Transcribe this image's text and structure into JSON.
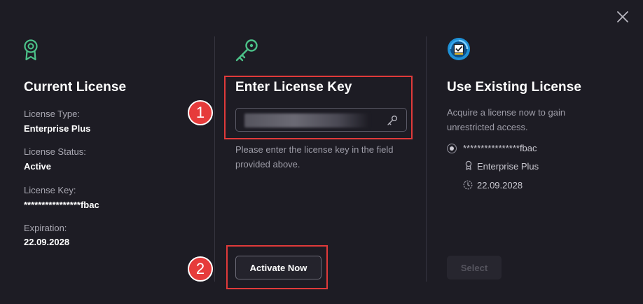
{
  "dialog": {
    "close_icon": "close-icon"
  },
  "current_license": {
    "icon": "award-ribbon-icon",
    "title": "Current License",
    "type_label": "License Type:",
    "type_value": "Enterprise Plus",
    "status_label": "License Status:",
    "status_value": "Active",
    "key_label": "License Key:",
    "key_value": "****************fbac",
    "expiration_label": "Expiration:",
    "expiration_value": "22.09.2028"
  },
  "enter_key": {
    "icon": "key-icon",
    "title": "Enter License Key",
    "input_value": "",
    "input_placeholder": "",
    "help_text": "Please enter the license key in the field provided above.",
    "activate_label": "Activate Now"
  },
  "existing_license": {
    "icon": "license-shield-icon",
    "title": "Use Existing License",
    "description": "Acquire a license now to gain unrestricted access.",
    "option_key": "****************fbac",
    "option_edition": "Enterprise Plus",
    "option_date": "22.09.2028",
    "select_label": "Select"
  },
  "annotations": {
    "step1": "1",
    "step2": "2"
  },
  "colors": {
    "background": "#1d1c24",
    "accent_green": "#4cc38a",
    "highlight_red": "#e03a3a",
    "icon_blue": "#1e90d6"
  }
}
